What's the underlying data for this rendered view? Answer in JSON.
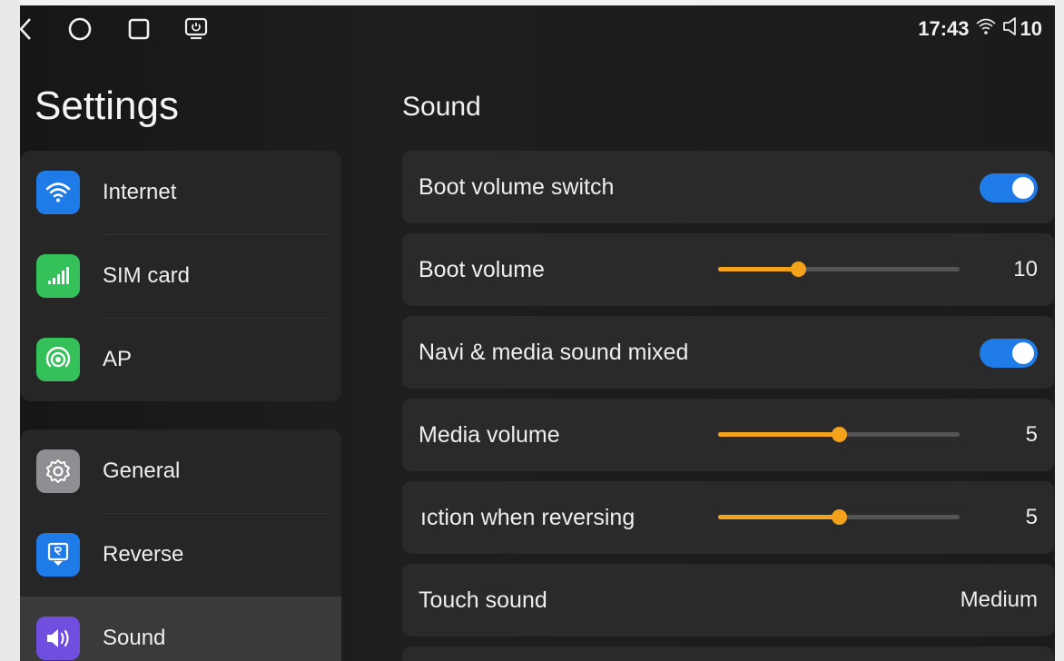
{
  "status_bar": {
    "nav_icons": [
      "back-icon",
      "home-icon",
      "recent-apps-icon",
      "screen-power-icon"
    ],
    "time": "17:43",
    "wifi_icon": "wifi-icon",
    "volume_icon": "volume-icon",
    "volume_level": "10"
  },
  "sidebar": {
    "title": "Settings",
    "groups": [
      {
        "items": [
          {
            "label": "Internet",
            "icon": "wifi-icon",
            "color": "#1f7be8"
          },
          {
            "label": "SIM card",
            "icon": "signal-icon",
            "color": "#35c15a"
          },
          {
            "label": "AP",
            "icon": "hotspot-icon",
            "color": "#35c15a"
          }
        ]
      },
      {
        "items": [
          {
            "label": "General",
            "icon": "gear-icon",
            "color": "#8e8e93"
          },
          {
            "label": "Reverse",
            "icon": "reverse-camera-icon",
            "color": "#1f7be8"
          },
          {
            "label": "Sound",
            "icon": "speaker-icon",
            "color": "#6f4ee0",
            "selected": true
          }
        ]
      }
    ]
  },
  "main": {
    "title": "Sound",
    "rows": [
      {
        "label": "Boot volume switch",
        "type": "toggle",
        "on": true
      },
      {
        "label": "Boot volume",
        "type": "slider",
        "value": "10",
        "level": 0.33
      },
      {
        "label": "Navi & media sound mixed",
        "type": "toggle",
        "on": true
      },
      {
        "label": "Media volume",
        "type": "slider",
        "value": "5",
        "level": 0.5
      },
      {
        "label": "ıction when reversing",
        "type": "slider",
        "value": "5",
        "level": 0.5
      },
      {
        "label": "Touch sound",
        "type": "value",
        "value": "Medium"
      }
    ]
  },
  "colors": {
    "accent_toggle": "#1f7be8",
    "accent_slider": "#f3a21c"
  }
}
